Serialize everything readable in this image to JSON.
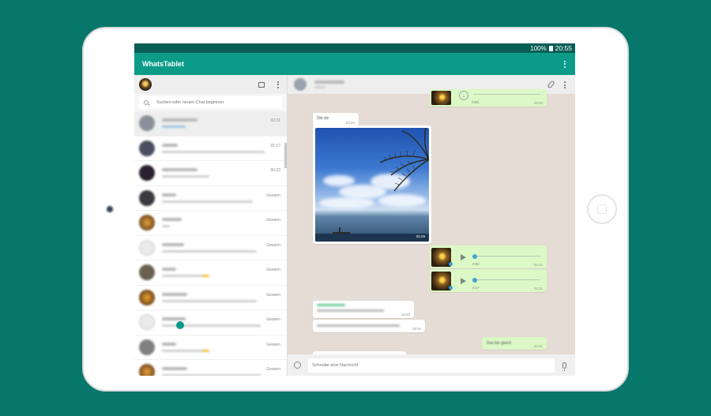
{
  "colors": {
    "background": "#08776b",
    "statusbar": "#075e54",
    "appbar": "#0c9b88",
    "chat_bg": "#e5ddd5",
    "outgoing": "#dcf8c6",
    "audio_progress": "#41a4d8"
  },
  "statusbar": {
    "battery": "100%",
    "time": "20:55"
  },
  "app": {
    "title": "WhatsTablet"
  },
  "search": {
    "placeholder": "Suchen oder neuen Chat beginnen"
  },
  "chats": [
    {
      "time": "02:31",
      "active": true
    },
    {
      "time": "01:17"
    },
    {
      "time": "00:23"
    },
    {
      "time": "Gestern"
    },
    {
      "time": "Gestern"
    },
    {
      "time": "Gestern"
    },
    {
      "time": "Gestern"
    },
    {
      "time": "Gestern"
    },
    {
      "time": "Gestern"
    },
    {
      "time": "Gestern"
    },
    {
      "time": "Gestern"
    }
  ],
  "messages": {
    "audio_top": {
      "duration": "0:08",
      "time": "02:08"
    },
    "text_in_1": {
      "text": "Die sie",
      "time": "02:24"
    },
    "image": {
      "time": "02:29"
    },
    "audio_1": {
      "duration": "0:05",
      "time": "02:31"
    },
    "audio_2": {
      "duration": "0:17",
      "time": "02:31"
    },
    "group_in_1": {
      "time": "18:50"
    },
    "group_in_2": {
      "time": "19:02"
    },
    "text_out": {
      "text": "Das bin gleich",
      "time": "20:01"
    }
  },
  "composer": {
    "placeholder": "Schreibe eine Nachricht"
  },
  "icons": [
    "chat-icon",
    "menu-icon",
    "search-icon",
    "attach-icon",
    "emoji-icon",
    "mic-icon",
    "play-icon",
    "download-icon"
  ]
}
